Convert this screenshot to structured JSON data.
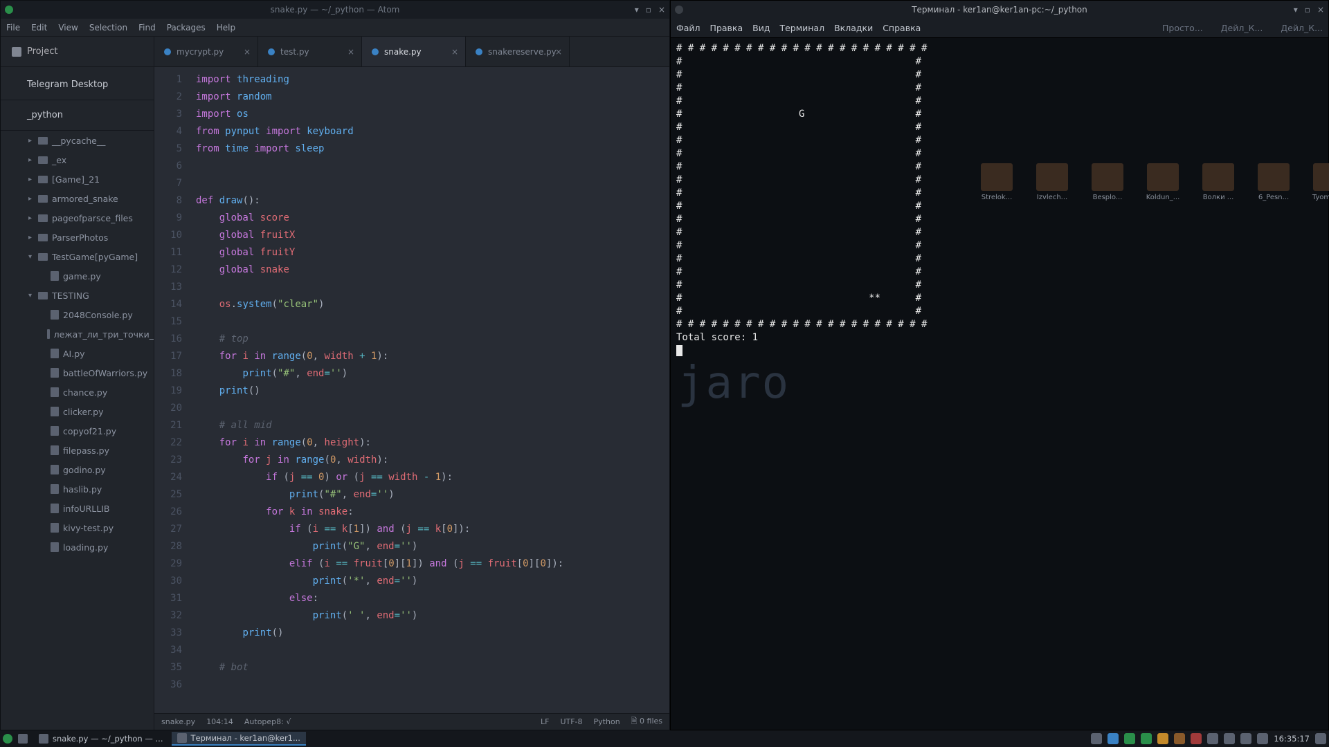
{
  "atom": {
    "title": "snake.py — ~/_python — Atom",
    "menu": [
      "File",
      "Edit",
      "View",
      "Selection",
      "Find",
      "Packages",
      "Help"
    ],
    "project_label": "Project",
    "tree_root": "Telegram Desktop",
    "project_folder": "_python",
    "folders": [
      "__pycache__",
      "_ex",
      "[Game]_21",
      "armored_snake",
      "pageofparsce_files",
      "ParserPhotos",
      "TestGame[pyGame]"
    ],
    "testgame_file": "game.py",
    "testing_folder": "TESTING",
    "files": [
      "2048Console.py",
      "лежат_ли_три_точки_",
      "AI.py",
      "battleOfWarriors.py",
      "chance.py",
      "clicker.py",
      "copyof21.py",
      "filepass.py",
      "godino.py",
      "haslib.py",
      "infoURLLIB",
      "kivy-test.py",
      "loading.py"
    ],
    "tabs": [
      {
        "name": "mycrypt.py",
        "active": false
      },
      {
        "name": "test.py",
        "active": false
      },
      {
        "name": "snake.py",
        "active": true
      },
      {
        "name": "snakereserve.py",
        "active": false
      }
    ],
    "status": {
      "file": "snake.py",
      "pos": "104:14",
      "autopep": "Autopep8: √",
      "lf": "LF",
      "enc": "UTF-8",
      "lang": "Python",
      "git": "0 files"
    },
    "code_lines": [
      {
        "n": 1,
        "html": "<span class='kw'>import</span> <span class='fn'>threading</span>"
      },
      {
        "n": 2,
        "html": "<span class='kw'>import</span> <span class='fn'>random</span>"
      },
      {
        "n": 3,
        "html": "<span class='kw'>import</span> <span class='fn'>os</span>"
      },
      {
        "n": 4,
        "html": "<span class='kw'>from</span> <span class='fn'>pynput</span> <span class='kw'>import</span> <span class='fn'>keyboard</span>"
      },
      {
        "n": 5,
        "html": "<span class='kw'>from</span> <span class='fn'>time</span> <span class='kw'>import</span> <span class='fn'>sleep</span>"
      },
      {
        "n": 6,
        "html": ""
      },
      {
        "n": 7,
        "html": ""
      },
      {
        "n": 8,
        "html": "<span class='kw'>def</span> <span class='fn'>draw</span>():"
      },
      {
        "n": 9,
        "html": "    <span class='kw'>global</span> <span class='id'>score</span>"
      },
      {
        "n": 10,
        "html": "    <span class='kw'>global</span> <span class='id'>fruitX</span>"
      },
      {
        "n": 11,
        "html": "    <span class='kw'>global</span> <span class='id'>fruitY</span>"
      },
      {
        "n": 12,
        "html": "    <span class='kw'>global</span> <span class='id'>snake</span>"
      },
      {
        "n": 13,
        "html": ""
      },
      {
        "n": 14,
        "html": "    <span class='id'>os</span>.<span class='fn'>system</span>(<span class='st'>\"clear\"</span>)"
      },
      {
        "n": 15,
        "html": ""
      },
      {
        "n": 16,
        "html": "    <span class='cm'># top</span>"
      },
      {
        "n": 17,
        "html": "    <span class='kw'>for</span> <span class='id'>i</span> <span class='kw'>in</span> <span class='fn'>range</span>(<span class='nm'>0</span>, <span class='id'>width</span> <span class='op'>+</span> <span class='nm'>1</span>):"
      },
      {
        "n": 18,
        "html": "        <span class='fn'>print</span>(<span class='st'>\"#\"</span>, <span class='id'>end</span><span class='op'>=</span><span class='st'>''</span>)"
      },
      {
        "n": 19,
        "html": "    <span class='fn'>print</span>()"
      },
      {
        "n": 20,
        "html": ""
      },
      {
        "n": 21,
        "html": "    <span class='cm'># all mid</span>"
      },
      {
        "n": 22,
        "html": "    <span class='kw'>for</span> <span class='id'>i</span> <span class='kw'>in</span> <span class='fn'>range</span>(<span class='nm'>0</span>, <span class='id'>height</span>):"
      },
      {
        "n": 23,
        "html": "        <span class='kw'>for</span> <span class='id'>j</span> <span class='kw'>in</span> <span class='fn'>range</span>(<span class='nm'>0</span>, <span class='id'>width</span>):"
      },
      {
        "n": 24,
        "html": "            <span class='kw'>if</span> (<span class='id'>j</span> <span class='op'>==</span> <span class='nm'>0</span>) <span class='kw'>or</span> (<span class='id'>j</span> <span class='op'>==</span> <span class='id'>width</span> <span class='op'>-</span> <span class='nm'>1</span>):"
      },
      {
        "n": 25,
        "html": "                <span class='fn'>print</span>(<span class='st'>\"#\"</span>, <span class='id'>end</span><span class='op'>=</span><span class='st'>''</span>)"
      },
      {
        "n": 26,
        "html": "            <span class='kw'>for</span> <span class='id'>k</span> <span class='kw'>in</span> <span class='id'>snake</span>:"
      },
      {
        "n": 27,
        "html": "                <span class='kw'>if</span> (<span class='id'>i</span> <span class='op'>==</span> <span class='id'>k</span>[<span class='nm'>1</span>]) <span class='kw'>and</span> (<span class='id'>j</span> <span class='op'>==</span> <span class='id'>k</span>[<span class='nm'>0</span>]):"
      },
      {
        "n": 28,
        "html": "                    <span class='fn'>print</span>(<span class='st'>\"G\"</span>, <span class='id'>end</span><span class='op'>=</span><span class='st'>''</span>)"
      },
      {
        "n": 29,
        "html": "                <span class='kw'>elif</span> (<span class='id'>i</span> <span class='op'>==</span> <span class='id'>fruit</span>[<span class='nm'>0</span>][<span class='nm'>1</span>]) <span class='kw'>and</span> (<span class='id'>j</span> <span class='op'>==</span> <span class='id'>fruit</span>[<span class='nm'>0</span>][<span class='nm'>0</span>]):"
      },
      {
        "n": 30,
        "html": "                    <span class='fn'>print</span>(<span class='st'>'*'</span>, <span class='id'>end</span><span class='op'>=</span><span class='st'>''</span>)"
      },
      {
        "n": 31,
        "html": "                <span class='kw'>else</span>:"
      },
      {
        "n": 32,
        "html": "                    <span class='fn'>print</span>(<span class='st'>' '</span>, <span class='id'>end</span><span class='op'>=</span><span class='st'>''</span>)"
      },
      {
        "n": 33,
        "html": "        <span class='fn'>print</span>()"
      },
      {
        "n": 34,
        "html": ""
      },
      {
        "n": 35,
        "html": "    <span class='cm'># bot</span>"
      },
      {
        "n": 36,
        "html": ""
      }
    ]
  },
  "terminal": {
    "title": "Терминал - ker1an@ker1an-pc:~/_python",
    "menu": [
      "Файл",
      "Правка",
      "Вид",
      "Терминал",
      "Вкладки",
      "Справка"
    ],
    "shortcuts_right": [
      "Просто...",
      "Дейл_К...",
      "Дейл_К..."
    ],
    "score_label": "Total score:",
    "score_value": "1",
    "watermark": "jaro",
    "board": {
      "width": 21,
      "height": 20,
      "head_col": 11,
      "head_row": 5,
      "fruit_col": 17,
      "fruit_row": 19
    }
  },
  "desktop_icons": [
    "Strelok...",
    "Izvlech...",
    "Besplo...",
    "Koldun_...",
    "Волки ...",
    "6_Pesn...",
    "Tyomna..."
  ],
  "taskbar": {
    "apps": [
      {
        "label": "snake.py — ~/_python — ...",
        "active": false
      },
      {
        "label": "Терминал - ker1an@ker1...",
        "active": true
      }
    ],
    "clock": "16:35:17"
  }
}
